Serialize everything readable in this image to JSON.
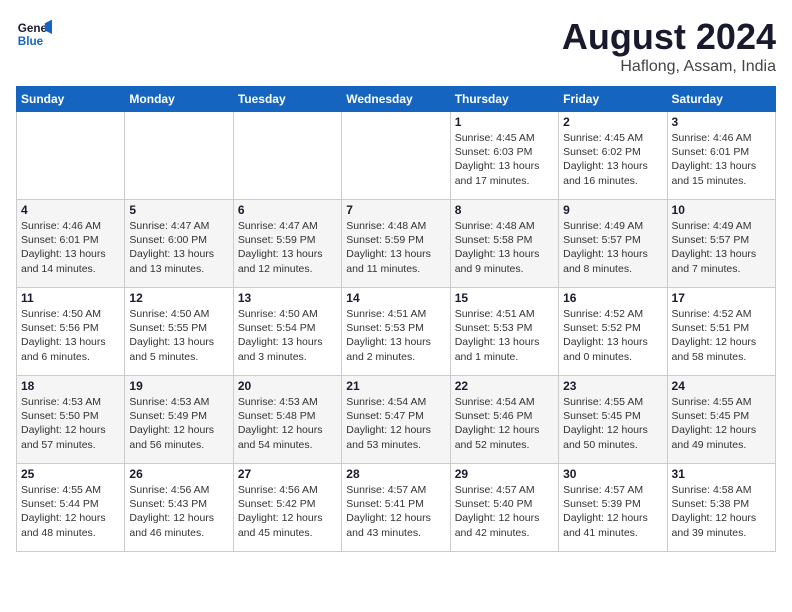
{
  "logo": {
    "line1": "General",
    "line2": "Blue"
  },
  "title": "August 2024",
  "subtitle": "Haflong, Assam, India",
  "days_of_week": [
    "Sunday",
    "Monday",
    "Tuesday",
    "Wednesday",
    "Thursday",
    "Friday",
    "Saturday"
  ],
  "weeks": [
    [
      {
        "day": "",
        "info": ""
      },
      {
        "day": "",
        "info": ""
      },
      {
        "day": "",
        "info": ""
      },
      {
        "day": "",
        "info": ""
      },
      {
        "day": "1",
        "info": "Sunrise: 4:45 AM\nSunset: 6:03 PM\nDaylight: 13 hours\nand 17 minutes."
      },
      {
        "day": "2",
        "info": "Sunrise: 4:45 AM\nSunset: 6:02 PM\nDaylight: 13 hours\nand 16 minutes."
      },
      {
        "day": "3",
        "info": "Sunrise: 4:46 AM\nSunset: 6:01 PM\nDaylight: 13 hours\nand 15 minutes."
      }
    ],
    [
      {
        "day": "4",
        "info": "Sunrise: 4:46 AM\nSunset: 6:01 PM\nDaylight: 13 hours\nand 14 minutes."
      },
      {
        "day": "5",
        "info": "Sunrise: 4:47 AM\nSunset: 6:00 PM\nDaylight: 13 hours\nand 13 minutes."
      },
      {
        "day": "6",
        "info": "Sunrise: 4:47 AM\nSunset: 5:59 PM\nDaylight: 13 hours\nand 12 minutes."
      },
      {
        "day": "7",
        "info": "Sunrise: 4:48 AM\nSunset: 5:59 PM\nDaylight: 13 hours\nand 11 minutes."
      },
      {
        "day": "8",
        "info": "Sunrise: 4:48 AM\nSunset: 5:58 PM\nDaylight: 13 hours\nand 9 minutes."
      },
      {
        "day": "9",
        "info": "Sunrise: 4:49 AM\nSunset: 5:57 PM\nDaylight: 13 hours\nand 8 minutes."
      },
      {
        "day": "10",
        "info": "Sunrise: 4:49 AM\nSunset: 5:57 PM\nDaylight: 13 hours\nand 7 minutes."
      }
    ],
    [
      {
        "day": "11",
        "info": "Sunrise: 4:50 AM\nSunset: 5:56 PM\nDaylight: 13 hours\nand 6 minutes."
      },
      {
        "day": "12",
        "info": "Sunrise: 4:50 AM\nSunset: 5:55 PM\nDaylight: 13 hours\nand 5 minutes."
      },
      {
        "day": "13",
        "info": "Sunrise: 4:50 AM\nSunset: 5:54 PM\nDaylight: 13 hours\nand 3 minutes."
      },
      {
        "day": "14",
        "info": "Sunrise: 4:51 AM\nSunset: 5:53 PM\nDaylight: 13 hours\nand 2 minutes."
      },
      {
        "day": "15",
        "info": "Sunrise: 4:51 AM\nSunset: 5:53 PM\nDaylight: 13 hours\nand 1 minute."
      },
      {
        "day": "16",
        "info": "Sunrise: 4:52 AM\nSunset: 5:52 PM\nDaylight: 13 hours\nand 0 minutes."
      },
      {
        "day": "17",
        "info": "Sunrise: 4:52 AM\nSunset: 5:51 PM\nDaylight: 12 hours\nand 58 minutes."
      }
    ],
    [
      {
        "day": "18",
        "info": "Sunrise: 4:53 AM\nSunset: 5:50 PM\nDaylight: 12 hours\nand 57 minutes."
      },
      {
        "day": "19",
        "info": "Sunrise: 4:53 AM\nSunset: 5:49 PM\nDaylight: 12 hours\nand 56 minutes."
      },
      {
        "day": "20",
        "info": "Sunrise: 4:53 AM\nSunset: 5:48 PM\nDaylight: 12 hours\nand 54 minutes."
      },
      {
        "day": "21",
        "info": "Sunrise: 4:54 AM\nSunset: 5:47 PM\nDaylight: 12 hours\nand 53 minutes."
      },
      {
        "day": "22",
        "info": "Sunrise: 4:54 AM\nSunset: 5:46 PM\nDaylight: 12 hours\nand 52 minutes."
      },
      {
        "day": "23",
        "info": "Sunrise: 4:55 AM\nSunset: 5:45 PM\nDaylight: 12 hours\nand 50 minutes."
      },
      {
        "day": "24",
        "info": "Sunrise: 4:55 AM\nSunset: 5:45 PM\nDaylight: 12 hours\nand 49 minutes."
      }
    ],
    [
      {
        "day": "25",
        "info": "Sunrise: 4:55 AM\nSunset: 5:44 PM\nDaylight: 12 hours\nand 48 minutes."
      },
      {
        "day": "26",
        "info": "Sunrise: 4:56 AM\nSunset: 5:43 PM\nDaylight: 12 hours\nand 46 minutes."
      },
      {
        "day": "27",
        "info": "Sunrise: 4:56 AM\nSunset: 5:42 PM\nDaylight: 12 hours\nand 45 minutes."
      },
      {
        "day": "28",
        "info": "Sunrise: 4:57 AM\nSunset: 5:41 PM\nDaylight: 12 hours\nand 43 minutes."
      },
      {
        "day": "29",
        "info": "Sunrise: 4:57 AM\nSunset: 5:40 PM\nDaylight: 12 hours\nand 42 minutes."
      },
      {
        "day": "30",
        "info": "Sunrise: 4:57 AM\nSunset: 5:39 PM\nDaylight: 12 hours\nand 41 minutes."
      },
      {
        "day": "31",
        "info": "Sunrise: 4:58 AM\nSunset: 5:38 PM\nDaylight: 12 hours\nand 39 minutes."
      }
    ]
  ]
}
